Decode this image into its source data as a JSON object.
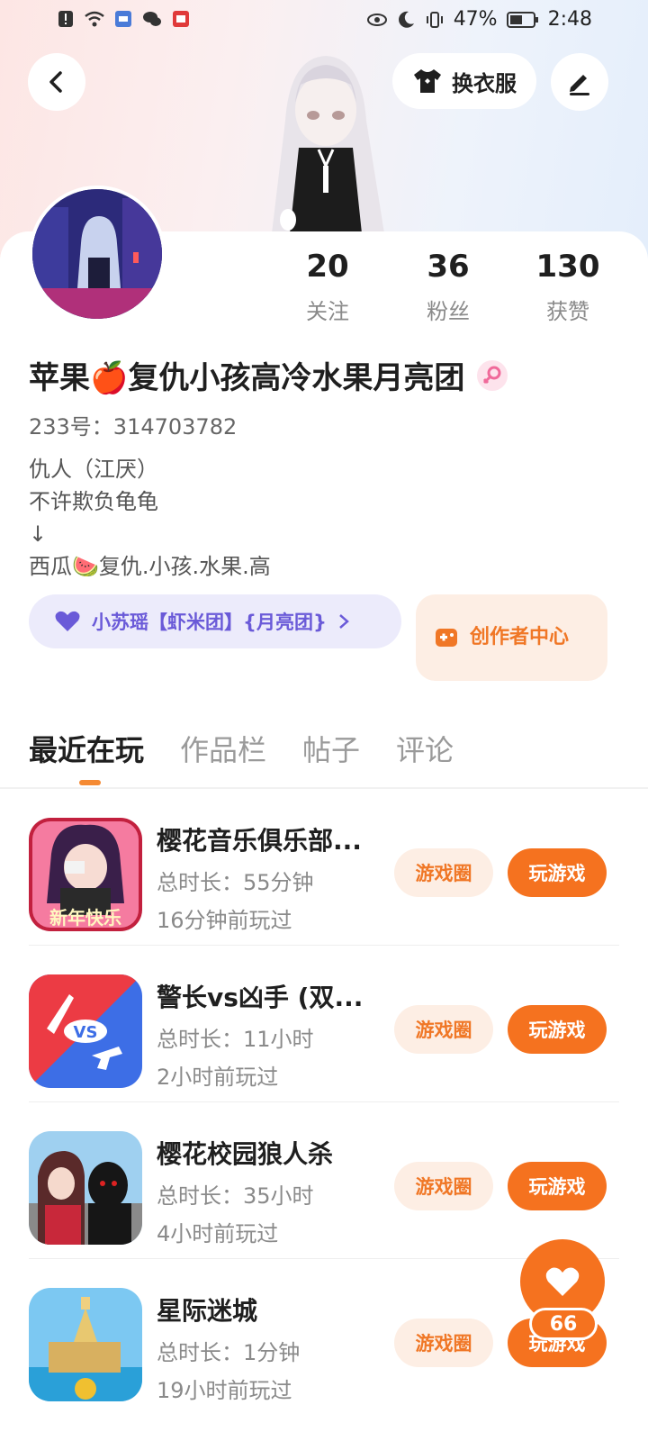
{
  "status_bar": {
    "battery": "47%",
    "time": "2:48"
  },
  "header": {
    "dress_label": "换衣服"
  },
  "profile": {
    "stats": [
      {
        "value": "20",
        "label": "关注"
      },
      {
        "value": "36",
        "label": "粉丝"
      },
      {
        "value": "130",
        "label": "获赞"
      }
    ],
    "name": "苹果🍎复仇小孩高冷水果月亮团",
    "uid": "233号：314703782",
    "bio": [
      "仇人（江厌）",
      "不许欺负龟龟",
      "↓",
      "西瓜🍉复仇.小孩.水果.高"
    ],
    "tag_label": "小苏瑶【虾米团】{月亮团}",
    "creator_label": "创作者中心"
  },
  "tabs": [
    "最近在玩",
    "作品栏",
    "帖子",
    "评论"
  ],
  "games": [
    {
      "title": "樱花音乐俱乐部...",
      "duration": "总时长：55分钟",
      "last_played": "16分钟前玩过",
      "icon": "sakura-music-icon",
      "circle_label": "游戏圈",
      "play_label": "玩游戏",
      "icon_text": "新年快乐"
    },
    {
      "title": "警长vs凶手 (双...",
      "duration": "总时长：11小时",
      "last_played": "2小时前玩过",
      "icon": "sheriff-vs-murderer-icon",
      "circle_label": "游戏圈",
      "play_label": "玩游戏",
      "icon_text": "VS"
    },
    {
      "title": "樱花校园狼人杀",
      "duration": "总时长：35小时",
      "last_played": "4小时前玩过",
      "icon": "sakura-werewolf-icon",
      "circle_label": "游戏圈",
      "play_label": "玩游戏"
    },
    {
      "title": "星际迷城",
      "duration": "总时长：1分钟",
      "last_played": "19小时前玩过",
      "icon": "star-maze-icon",
      "circle_label": "游戏圈",
      "play_label": "玩游戏"
    }
  ],
  "like": {
    "count": "66"
  },
  "colors": {
    "accent": "#f5721f",
    "accent_light": "#fdeee4",
    "tag_text": "#6a5ad8"
  }
}
